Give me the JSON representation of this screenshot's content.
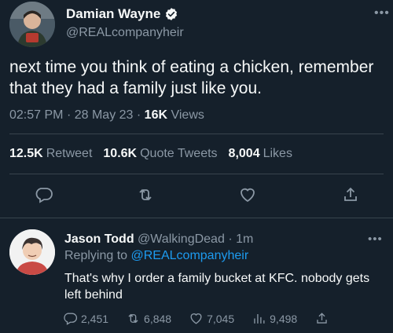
{
  "tweet": {
    "author_name": "Damian Wayne",
    "author_handle": "@REALcompanyheir",
    "text": "next time you think of eating a chicken, remember that they had a family just like you.",
    "time": "02:57 PM",
    "date": "28 May 23",
    "views_count": "16K",
    "views_label": "Views",
    "separator": "·",
    "retweets_count": "12.5K",
    "retweets_label": "Retweet",
    "quotes_count": "10.6K",
    "quotes_label": "Quote Tweets",
    "likes_count": "8,004",
    "likes_label": "Likes"
  },
  "reply": {
    "author_name": "Jason Todd",
    "author_handle": "@WalkingDead",
    "separator": "·",
    "age": "1m",
    "replying_prefix": "Replying to",
    "replying_to": "@REALcompanyheir",
    "text": "That's why I order a family bucket at KFC. nobody gets left behind",
    "replies": "2,451",
    "retweets": "6,848",
    "likes": "7,045",
    "views": "9,498"
  },
  "colors": {
    "background": "#15202b",
    "accent": "#1d9bf0",
    "muted": "#8b98a5",
    "divider": "#38444d"
  },
  "icons": {
    "more": "more-horizontal-icon",
    "verified": "verified-badge-icon",
    "reply": "reply-bubble-icon",
    "retweet": "retweet-icon",
    "like": "heart-icon",
    "share": "share-upload-icon",
    "views": "views-bar-chart-icon"
  }
}
